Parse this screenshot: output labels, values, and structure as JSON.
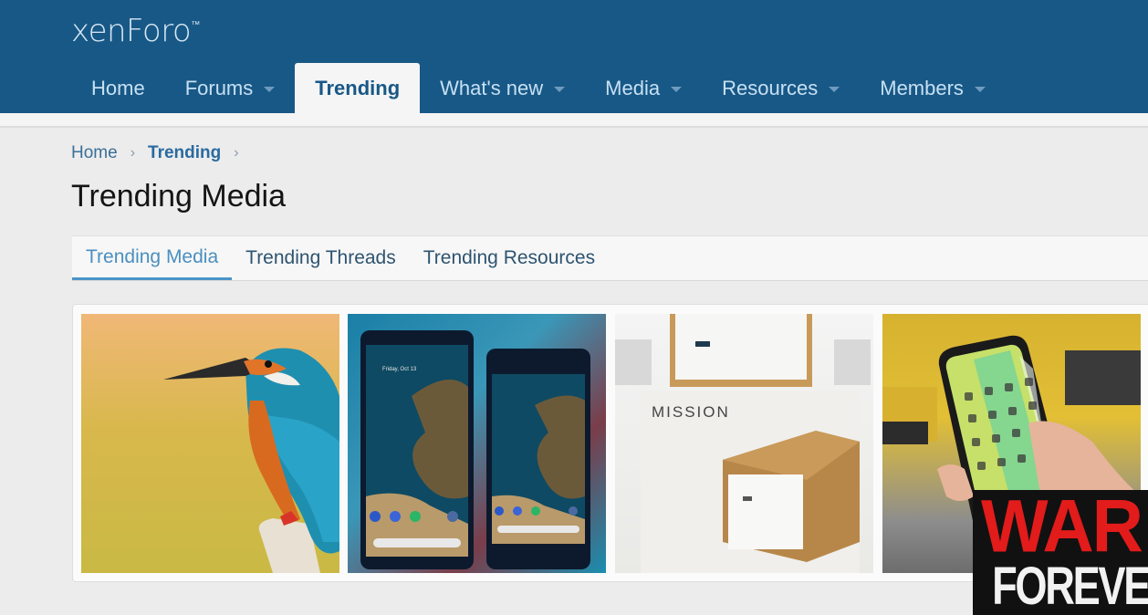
{
  "header": {
    "logo": "xenForo",
    "logo_mark": "™",
    "nav": [
      {
        "label": "Home",
        "has_dropdown": false,
        "active": false
      },
      {
        "label": "Forums",
        "has_dropdown": true,
        "active": false
      },
      {
        "label": "Trending",
        "has_dropdown": false,
        "active": true
      },
      {
        "label": "What's new",
        "has_dropdown": true,
        "active": false
      },
      {
        "label": "Media",
        "has_dropdown": true,
        "active": false
      },
      {
        "label": "Resources",
        "has_dropdown": true,
        "active": false
      },
      {
        "label": "Members",
        "has_dropdown": true,
        "active": false
      }
    ]
  },
  "breadcrumb": [
    {
      "label": "Home"
    },
    {
      "label": "Trending"
    }
  ],
  "breadcrumb_separator": "›",
  "page_title": "Trending Media",
  "tabs": [
    {
      "label": "Trending Media",
      "active": true
    },
    {
      "label": "Trending Threads",
      "active": false
    },
    {
      "label": "Trending Resources",
      "active": false
    }
  ],
  "media": [
    {
      "subject": "Kingfisher bird perched on a post"
    },
    {
      "subject": "Two Google Pixel 2 phones",
      "screen_text": "Friday, Oct 13"
    },
    {
      "subject": "Mission wooden speaker box",
      "box_label": "MISSION"
    },
    {
      "subject": "Hand holding an iPhone X"
    }
  ],
  "overlay": {
    "line1": "WAR",
    "line2": "FOREVER",
    "colors": {
      "line1": "#e21b1b",
      "line2": "#f2f2f2",
      "background": "#111111"
    }
  },
  "colors": {
    "header_bg": "#185886",
    "nav_text": "#c7e0f3",
    "active_tab_text": "#4a8fc0",
    "link": "#3a6f99"
  }
}
